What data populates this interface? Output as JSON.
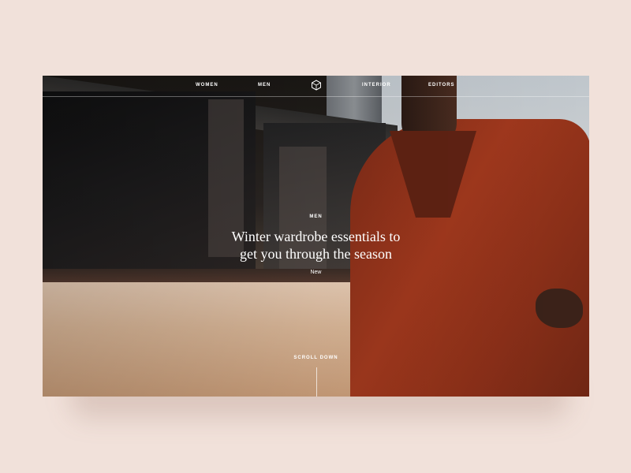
{
  "nav": {
    "items": [
      "WOMEN",
      "MEN",
      "INTERIOR",
      "EDITORS"
    ],
    "logo": "cube-logo-icon"
  },
  "hero": {
    "kicker": "MEN",
    "headline_line1": "Winter wardrobe essentials to",
    "headline_line2": "get you through the season",
    "tag": "New",
    "scroll_label": "SCROLL DOWN"
  },
  "colors": {
    "page_bg": "#f1e1da",
    "jacket": "#a0381d",
    "text": "#ffffff"
  }
}
